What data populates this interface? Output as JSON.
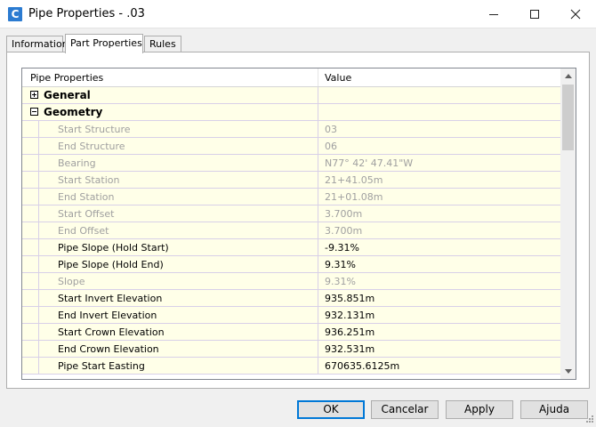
{
  "window": {
    "title": "Pipe Properties - .03",
    "app_icon_glyph": "C"
  },
  "tabs": [
    {
      "label": "Information"
    },
    {
      "label": "Part Properties"
    },
    {
      "label": "Rules"
    }
  ],
  "grid": {
    "headers": {
      "name": "Pipe Properties",
      "value": "Value"
    },
    "groups": [
      {
        "label": "General",
        "expander": "+",
        "expanded": false
      },
      {
        "label": "Geometry",
        "expander": "−",
        "expanded": true
      }
    ],
    "rows": [
      {
        "name": "Start Structure",
        "value": "03",
        "enabled": false
      },
      {
        "name": "End Structure",
        "value": "06",
        "enabled": false
      },
      {
        "name": "Bearing",
        "value": "N77° 42' 47.41\"W",
        "enabled": false
      },
      {
        "name": "Start Station",
        "value": "21+41.05m",
        "enabled": false
      },
      {
        "name": "End Station",
        "value": "21+01.08m",
        "enabled": false
      },
      {
        "name": "Start Offset",
        "value": "3.700m",
        "enabled": false
      },
      {
        "name": "End Offset",
        "value": "3.700m",
        "enabled": false
      },
      {
        "name": "Pipe Slope (Hold Start)",
        "value": "-9.31%",
        "enabled": true
      },
      {
        "name": "Pipe Slope (Hold End)",
        "value": "9.31%",
        "enabled": true
      },
      {
        "name": "Slope",
        "value": "9.31%",
        "enabled": false
      },
      {
        "name": "Start Invert Elevation",
        "value": "935.851m",
        "enabled": true
      },
      {
        "name": "End Invert Elevation",
        "value": "932.131m",
        "enabled": true
      },
      {
        "name": "Start Crown Elevation",
        "value": "936.251m",
        "enabled": true
      },
      {
        "name": "End Crown Elevation",
        "value": "932.531m",
        "enabled": true
      },
      {
        "name": "Pipe Start Easting",
        "value": "670635.6125m",
        "enabled": true
      }
    ]
  },
  "buttons": {
    "ok": "OK",
    "cancel": "Cancelar",
    "apply": "Apply",
    "help": "Ajuda"
  },
  "colors": {
    "row_background": "#ffffe8",
    "ok_border": "#0078d7",
    "app_icon": "#2b7bd1"
  }
}
